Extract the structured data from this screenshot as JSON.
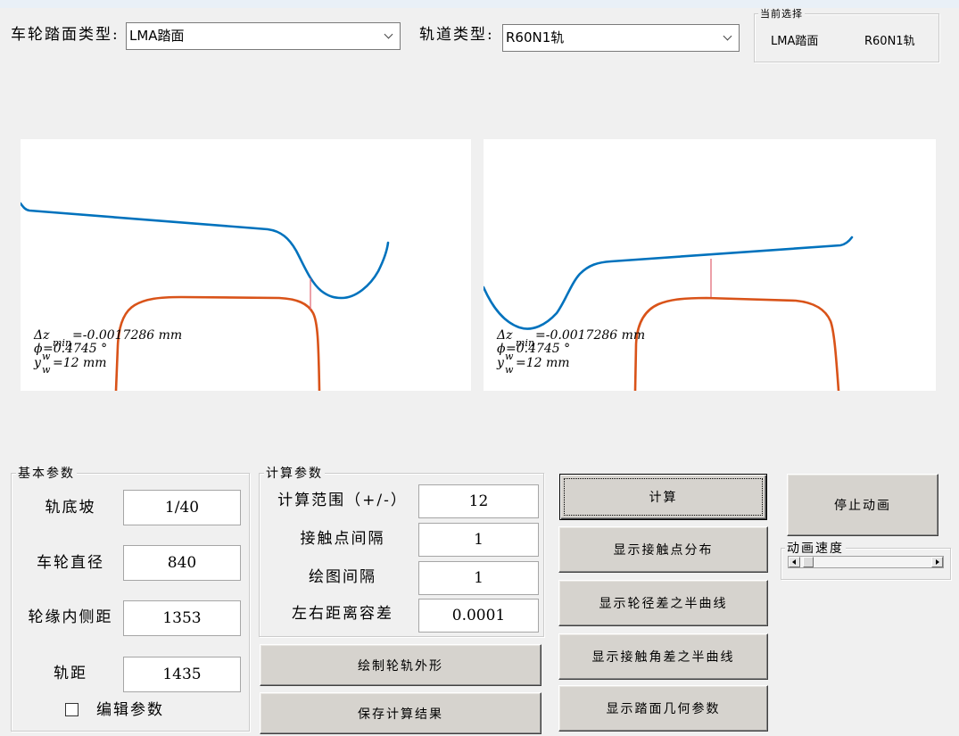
{
  "selection": {
    "wheel_label": "车轮踏面类型:",
    "wheel_value": "LMA踏面",
    "rail_label": "轨道类型:",
    "rail_value": "R60N1轨"
  },
  "current_selection": {
    "title": "当前选择",
    "wheel": "LMA踏面",
    "rail": "R60N1轨"
  },
  "plots": {
    "colors": {
      "wheel_profile": "#0072BD",
      "rail_profile": "#D95319",
      "contact_line": "#E0606E"
    },
    "left": {
      "dz_symbol": "Δz",
      "dz_sub": "min",
      "dz_value": "=-0.0017286 mm",
      "phi_symbol": "ϕ",
      "phi_value": "=0.4745 °",
      "y_symbol": "y",
      "y_sup": "w",
      "y_sub": "w",
      "y_value": "=12 mm"
    },
    "right": {
      "dz_symbol": "Δz",
      "dz_sub": "min",
      "dz_value": "=-0.0017286 mm",
      "phi_symbol": "ϕ",
      "phi_value": "=0.4745 °",
      "y_symbol": "y",
      "y_sup": "w",
      "y_sub": "w",
      "y_value": "=12 mm"
    }
  },
  "basic_params": {
    "title": "基本参数",
    "fields": [
      {
        "label": "轨底坡",
        "value": "1/40"
      },
      {
        "label": "车轮直径",
        "value": "840"
      },
      {
        "label": "轮缘内侧距",
        "value": "1353"
      },
      {
        "label": "轨距",
        "value": "1435"
      }
    ],
    "edit_checkbox": {
      "label": "编辑参数",
      "checked": false
    }
  },
  "calc_params": {
    "title": "计算参数",
    "fields": [
      {
        "label": "计算范围（+/-）",
        "value": "12"
      },
      {
        "label": "接触点间隔",
        "value": "1"
      },
      {
        "label": "绘图间隔",
        "value": "1"
      },
      {
        "label": "左右距离容差",
        "value": "0.0001"
      }
    ]
  },
  "buttons": {
    "draw_profiles": "绘制轮轨外形",
    "save_results": "保存计算结果",
    "calculate": "计算",
    "show_contact_points": "显示接触点分布",
    "show_rolling_radius_diff": "显示轮径差之半曲线",
    "show_contact_angle_diff": "显示接触角差之半曲线",
    "show_tread_geometry": "显示踏面几何参数",
    "stop_animation": "停止动画"
  },
  "animation_speed": {
    "title": "动画速度",
    "level": 0.02
  }
}
